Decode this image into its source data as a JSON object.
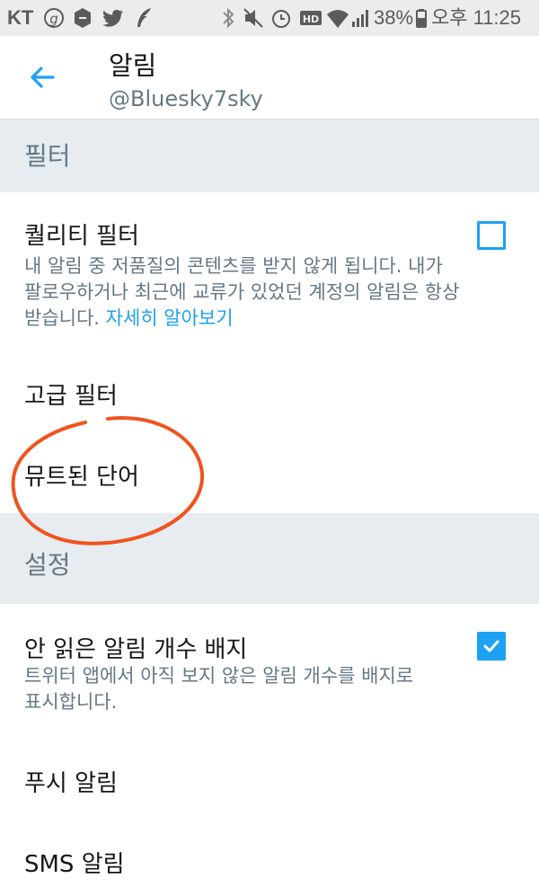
{
  "status_bar": {
    "carrier": "KT",
    "battery": "38%",
    "time": "오후 11:25",
    "icons": [
      "g-circle-icon",
      "shield-app-icon",
      "twitter-bird-icon",
      "feather-icon",
      "bluetooth-icon",
      "mute-icon",
      "alarm-icon",
      "hd-icon",
      "wifi-icon",
      "signal-icon",
      "battery-icon"
    ]
  },
  "header": {
    "title": "알림",
    "username": "@Bluesky7sky",
    "back_icon": "arrow-left-icon"
  },
  "sections": {
    "filters": {
      "label": "필터",
      "quality_filter": {
        "title": "퀄리티 필터",
        "desc_line1": "내 알림 중 저품질의 콘텐츠를 받지 않게 됩니다. 내가",
        "desc_line2": "팔로우하거나 최근에 교류가 있었던 계정의 알림은 항상",
        "desc_line3": "받습니다.",
        "learn_more": "자세히 알아보기",
        "checked": false
      },
      "advanced_filter": {
        "title": "고급 필터"
      },
      "muted_words": {
        "title": "뮤트된 단어"
      }
    },
    "settings": {
      "label": "설정",
      "unread_badge": {
        "title": "안 읽은 알림 개수 배지",
        "desc_line1": "트위터 앱에서 아직 보지 않은 알림 개수를 배지로",
        "desc_line2": "표시합니다.",
        "checked": true
      },
      "push": {
        "title": "푸시 알림"
      },
      "sms": {
        "title": "SMS 알림"
      }
    }
  },
  "colors": {
    "accent": "#1da1f2",
    "section_bg": "#e6ecf0",
    "annotation": "#f0541e"
  }
}
